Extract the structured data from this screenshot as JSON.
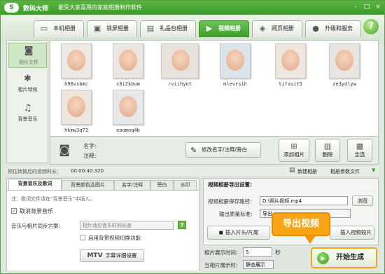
{
  "app": {
    "logo": "S",
    "name": "数码大师",
    "subtitle": "最受大家喜用的家庭相册制作软件"
  },
  "window_buttons": [
    "-",
    "□",
    "×"
  ],
  "tabs": [
    {
      "label": "本机相册",
      "icon": "pc-album-icon"
    },
    {
      "label": "锁屏相册",
      "icon": "screen-icon"
    },
    {
      "label": "礼品包相册",
      "icon": "gift-icon"
    },
    {
      "label": "视频相册",
      "icon": "video-icon",
      "active": true
    },
    {
      "label": "网页相册",
      "icon": "web-icon"
    },
    {
      "label": "升级和服务",
      "icon": "upgrade-icon"
    }
  ],
  "help": "?",
  "leftnav": [
    {
      "label": "相片文件",
      "icon": "camera-icon",
      "selected": true
    },
    {
      "label": "相片特效",
      "icon": "effects-icon"
    },
    {
      "label": "背景音乐",
      "icon": "music-icon"
    }
  ],
  "photos": [
    "h96vsbmc",
    "c0i2kbum",
    "rviihyot",
    "mlevrsih",
    "tifvuit5",
    "ze3ydlyw",
    "hkmw3q73",
    "eoomnq4b"
  ],
  "info": {
    "name_label": "名字:",
    "note_label": "注释:"
  },
  "buttons": {
    "edit": "修改名字/注释/旁白",
    "add": "添加相片",
    "delete": "删除",
    "select_all": "全选"
  },
  "strip": {
    "duration_label": "预估转换后的视频时长：",
    "duration": "00:00:40.320",
    "new_album": "新建相册",
    "album_params": "相册参数文件"
  },
  "left_panel": {
    "tabs": [
      "背景音乐及歌词",
      "背景颜色及图片",
      "名字/注释",
      "旁白",
      "水印"
    ],
    "hint": "注：歌词文件请在“背景音乐”中插入。",
    "cancel_music": "取消背景音乐",
    "sync_label": "音乐与相片同步方案:",
    "sync_option": "相片适应音乐时间长度",
    "sync_help": "?",
    "auto_switch": "启用背景视频切换功能",
    "mtv": "MTV",
    "lyrics_btn": "字幕详细设置"
  },
  "right_panel": {
    "title": "视频相册导出设置:",
    "path_label": "视频相册保存路径:",
    "path_value": "D:\\照片视频.mp4",
    "browse": "浏览",
    "quality_label": "输出质量标准:",
    "quality_value": "导出",
    "insert_head": "插入片头/片尾",
    "insert_clip": "插入视频短片",
    "photo_time_label": "相片展示时间:",
    "photo_time": "5",
    "photo_time_unit": "秒",
    "display_label": "当相片展示时:",
    "display_value": "静态展示"
  },
  "callout": "导出视频",
  "start": "开始生成",
  "colors": {
    "accent": "#3f9a2c",
    "callout": "#f7a516"
  }
}
